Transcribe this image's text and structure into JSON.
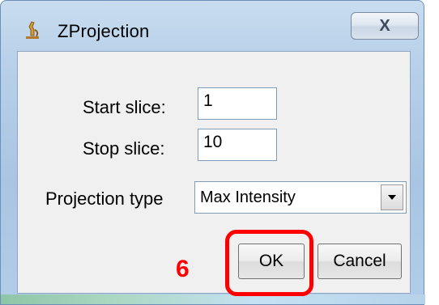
{
  "window": {
    "title": "ZProjection",
    "close_glyph": "X"
  },
  "form": {
    "start_slice": {
      "label": "Start slice:",
      "value": "1"
    },
    "stop_slice": {
      "label": "Stop slice:",
      "value": "10"
    },
    "projection_type": {
      "label": "Projection type",
      "selected": "Max Intensity"
    }
  },
  "buttons": {
    "ok": "OK",
    "cancel": "Cancel"
  },
  "annotation": {
    "step": "6",
    "color": "#ff0000"
  },
  "icons": {
    "app": "microscope-icon",
    "dropdown": "chevron-down-icon"
  }
}
